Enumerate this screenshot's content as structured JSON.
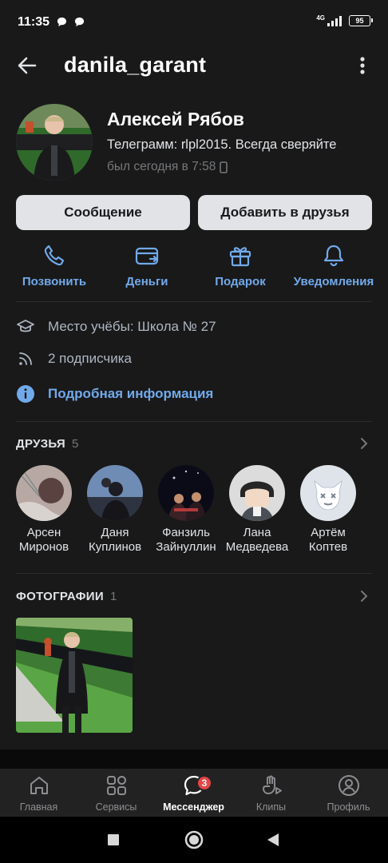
{
  "status_bar": {
    "time": "11:35",
    "network": "4G",
    "battery": "95"
  },
  "header": {
    "title": "danila_garant"
  },
  "profile": {
    "name": "Алексей Рябов",
    "status": "Телеграмм: rlpl2015. Всегда сверяйте",
    "last_seen": "был сегодня в 7:58"
  },
  "buttons": {
    "message": "Сообщение",
    "add_friend": "Добавить в друзья"
  },
  "actions": [
    {
      "label": "Позвонить",
      "icon": "phone-icon"
    },
    {
      "label": "Деньги",
      "icon": "money-card-icon"
    },
    {
      "label": "Подарок",
      "icon": "gift-icon"
    },
    {
      "label": "Уведомления",
      "icon": "bell-icon"
    }
  ],
  "info": {
    "education": "Место учёбы: Школа № 27",
    "followers": "2 подписчика",
    "details": "Подробная информация"
  },
  "friends_section": {
    "title": "ДРУЗЬЯ",
    "count": "5",
    "items": [
      {
        "first": "Арсен",
        "last": "Миронов"
      },
      {
        "first": "Даня",
        "last": "Куплинов"
      },
      {
        "first": "Фанзиль",
        "last": "Зайнуллин"
      },
      {
        "first": "Лана",
        "last": "Медведева"
      },
      {
        "first": "Артём",
        "last": "Коптев"
      }
    ]
  },
  "photos_section": {
    "title": "ФОТОГРАФИИ",
    "count": "1"
  },
  "tabbar": {
    "items": [
      {
        "label": "Главная",
        "icon": "home-icon"
      },
      {
        "label": "Сервисы",
        "icon": "services-icon"
      },
      {
        "label": "Мессенджер",
        "icon": "messenger-icon",
        "badge": "3",
        "active": true
      },
      {
        "label": "Клипы",
        "icon": "clips-icon"
      },
      {
        "label": "Профиль",
        "icon": "profile-icon"
      }
    ]
  },
  "colors": {
    "background": "#19191a",
    "accent": "#71aaeb",
    "badge": "#e64646"
  }
}
